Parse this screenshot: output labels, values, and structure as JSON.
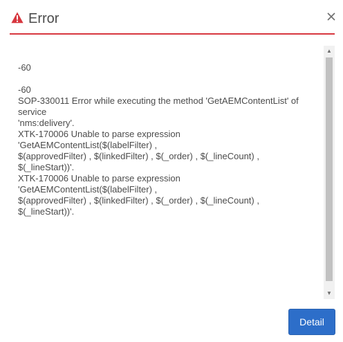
{
  "dialog": {
    "title": "Error",
    "close_icon": "close-icon",
    "alert_icon": "alert-triangle-icon",
    "message": "-60\n\n-60\nSOP-330011 Error while executing the method 'GetAEMContentList' of service\n'nms:delivery'.\nXTK-170006 Unable to parse expression 'GetAEMContentList($(labelFilter) ,\n$(approvedFilter) , $(linkedFilter) , $(_order) , $(_lineCount) , $(_lineStart))'.\nXTK-170006 Unable to parse expression 'GetAEMContentList($(labelFilter) ,\n$(approvedFilter) , $(linkedFilter) , $(_order) , $(_lineCount) , $(_lineStart))'.",
    "detail_label": "Detail"
  },
  "colors": {
    "accent_red": "#d7373f",
    "button_blue": "#2d6ec9"
  }
}
